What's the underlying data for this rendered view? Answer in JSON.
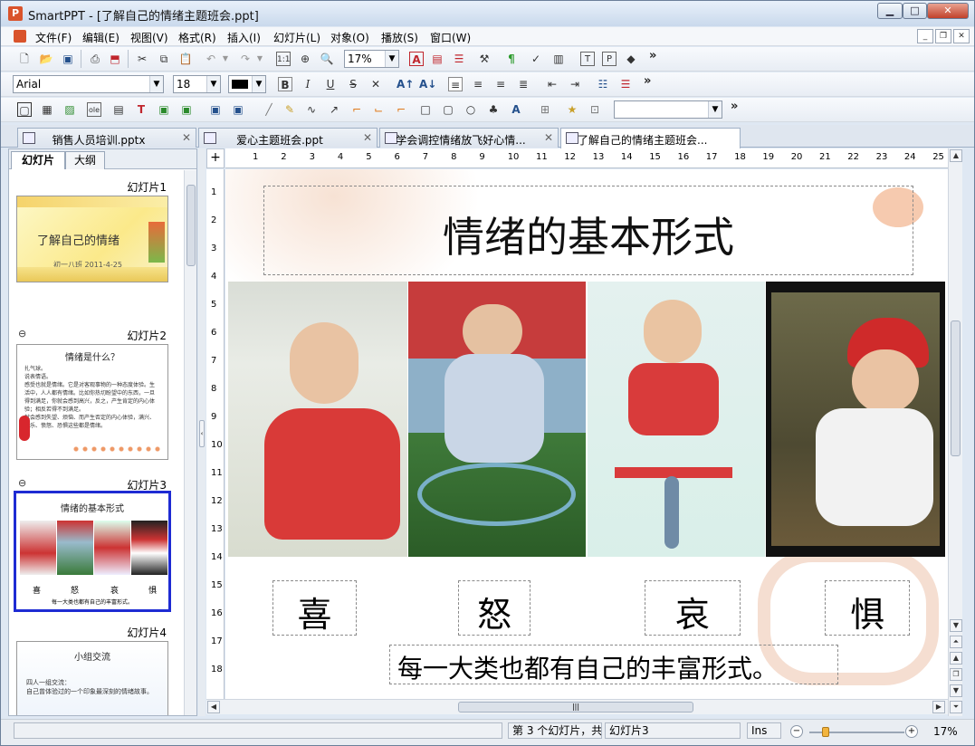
{
  "window": {
    "title": "SmartPPT - [了解自己的情绪主题班会.ppt]",
    "app_icon": "P"
  },
  "menu": [
    "文件(F)",
    "编辑(E)",
    "视图(V)",
    "格式(R)",
    "插入(I)",
    "幻灯片(L)",
    "对象(O)",
    "播放(S)",
    "窗口(W)"
  ],
  "toolbar": {
    "zoom_value": "17%",
    "font_name": "Arial",
    "font_size": "18",
    "more": "»"
  },
  "tabs": [
    {
      "label": "销售人员培训.pptx",
      "active": false
    },
    {
      "label": "爱心主题班会.ppt",
      "active": false
    },
    {
      "label": "学会调控情绪放飞好心情...",
      "active": false
    },
    {
      "label": "了解自己的情绪主题班会...",
      "active": true
    }
  ],
  "panel": {
    "tab_slides": "幻灯片",
    "tab_outline": "大纲"
  },
  "slides": [
    {
      "label": "幻灯片1",
      "title": "了解自己的情绪",
      "subtitle": "初一八班 2011-4-25"
    },
    {
      "label": "幻灯片2",
      "title": "情绪是什么？",
      "bullets": [
        "扎气球。",
        "说表情语。",
        "感受也就是情绪。它是对客观事物的一种态度体验。生活中，人人都有情绪。比如你热切盼望中的东西，一旦得到满足，你就会感到高兴，反之，产生肯定的内心体验；相反若得不到满足。",
        "就会感到失望、烦恼、而产生否定的内心体验，满兴、快乐、愤怒、恐惧这些都是情绪。"
      ]
    },
    {
      "label": "幻灯片3",
      "title": "情绪的基本形式"
    },
    {
      "label": "幻灯片4",
      "title": "小组交流",
      "text": "四人一组交流：\n自己曾体验过的一个印象最深刻的情绪故事。"
    }
  ],
  "slide": {
    "title": "情绪的基本形式",
    "emotions": [
      "喜",
      "怒",
      "哀",
      "惧"
    ],
    "caption": "每一大类也都有自己的丰富形式。"
  },
  "ruler_h": [
    "1",
    "2",
    "3",
    "4",
    "5",
    "6",
    "7",
    "8",
    "9",
    "10",
    "11",
    "12",
    "13",
    "14",
    "15",
    "16",
    "17",
    "18",
    "19",
    "20",
    "21",
    "22",
    "23",
    "24",
    "25"
  ],
  "ruler_v": [
    "1",
    "2",
    "3",
    "4",
    "5",
    "6",
    "7",
    "8",
    "9",
    "10",
    "11",
    "12",
    "13",
    "14",
    "15",
    "16",
    "17",
    "18"
  ],
  "status": {
    "slide_info": "第 3 个幻灯片，共",
    "slide_name": "幻灯片3",
    "ins": "Ins",
    "zoom": "17%"
  },
  "colors": {
    "selection": "#1e2bd3",
    "app_accent": "#d9532b",
    "title_gradient_top": "#e8f0fa"
  }
}
